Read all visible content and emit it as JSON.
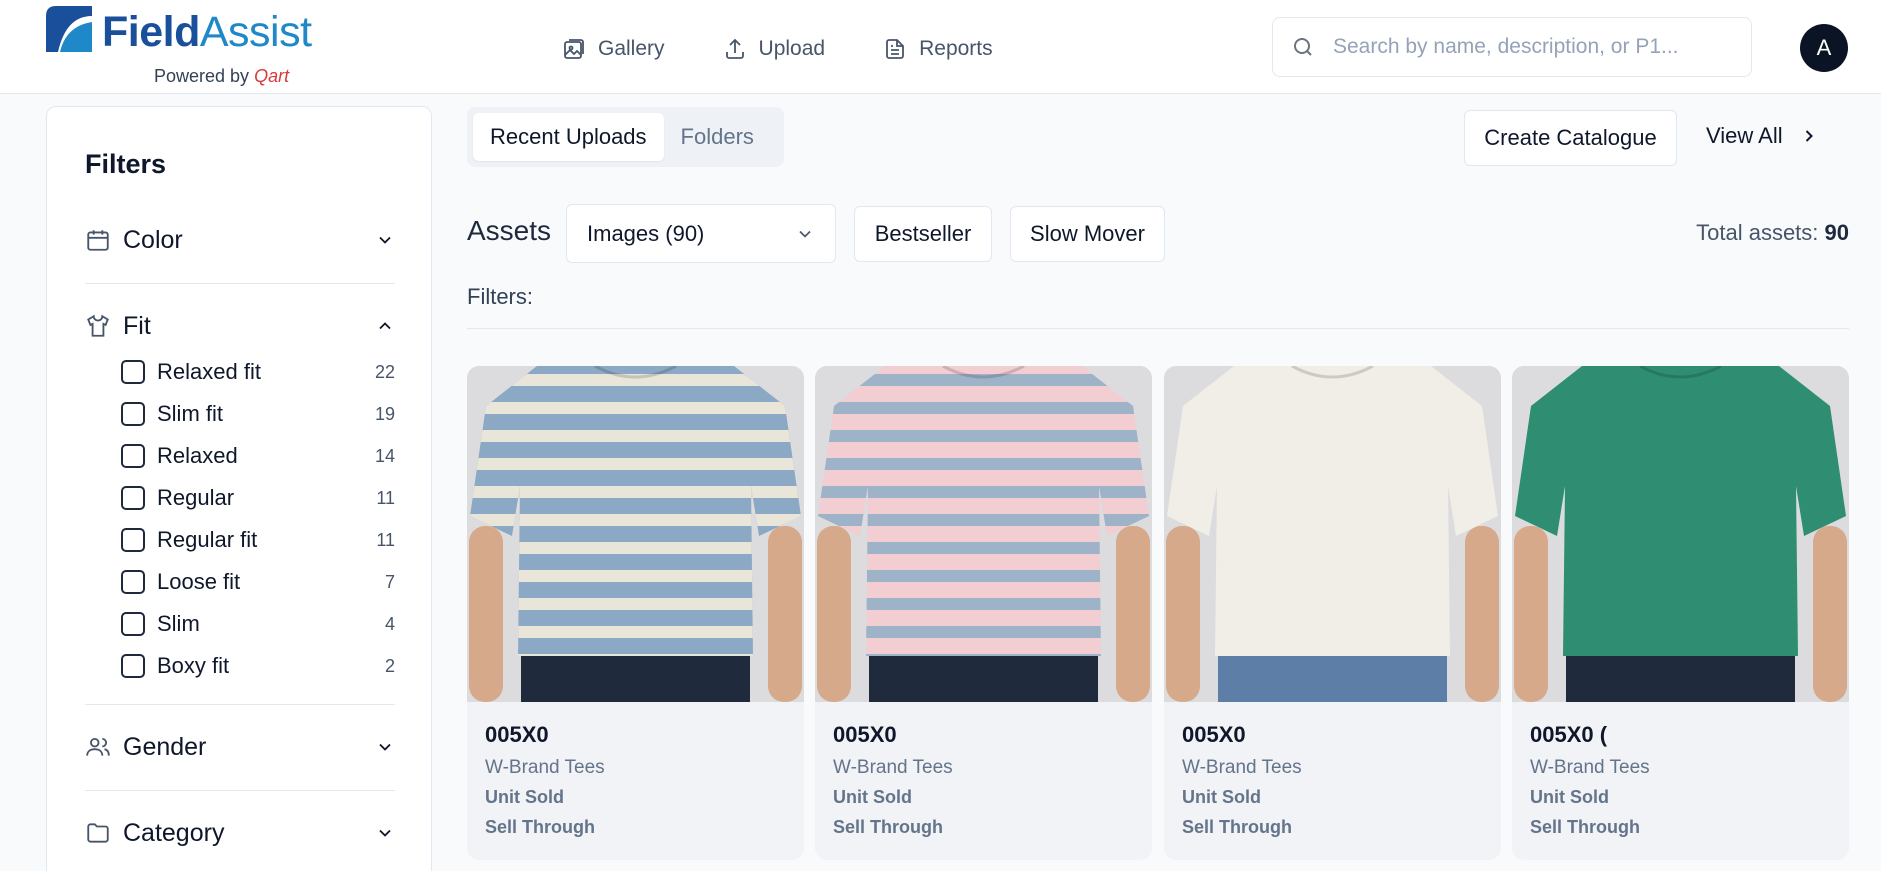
{
  "header": {
    "logo_primary": "Field",
    "logo_secondary": "Assist",
    "powered_prefix": "Powered by ",
    "powered_brand": "Qart",
    "nav": [
      {
        "label": "Gallery",
        "icon": "gallery-icon"
      },
      {
        "label": "Upload",
        "icon": "upload-icon"
      },
      {
        "label": "Reports",
        "icon": "reports-icon"
      }
    ],
    "search_placeholder": "Search by name, description, or P1...",
    "avatar_initial": "A"
  },
  "sidebar": {
    "title": "Filters",
    "sections": [
      {
        "label": "Color",
        "icon": "calendar-icon",
        "expanded": false
      },
      {
        "label": "Fit",
        "icon": "shirt-icon",
        "expanded": true,
        "options": [
          {
            "label": "Relaxed fit",
            "count": "22"
          },
          {
            "label": "Slim fit",
            "count": "19"
          },
          {
            "label": "Relaxed",
            "count": "14"
          },
          {
            "label": "Regular",
            "count": "11"
          },
          {
            "label": "Regular fit",
            "count": "11"
          },
          {
            "label": "Loose fit",
            "count": "7"
          },
          {
            "label": "Slim",
            "count": "4"
          },
          {
            "label": "Boxy fit",
            "count": "2"
          }
        ]
      },
      {
        "label": "Gender",
        "icon": "users-icon",
        "expanded": false
      },
      {
        "label": "Category",
        "icon": "folder-icon",
        "expanded": false
      }
    ]
  },
  "main": {
    "tabs": [
      {
        "label": "Recent Uploads",
        "active": true
      },
      {
        "label": "Folders",
        "active": false
      }
    ],
    "create_catalogue": "Create Catalogue",
    "view_all": "View All",
    "assets_label": "Assets",
    "asset_type_selected": "Images (90)",
    "bestseller": "Bestseller",
    "slow_mover": "Slow Mover",
    "total_label": "Total assets: ",
    "total_value": "90",
    "filters_label": "Filters:",
    "cards": [
      {
        "title": "005X0",
        "brand": "W-Brand Tees",
        "unit_sold": "Unit Sold",
        "sell_through": "Sell Through",
        "shirt_color": "#8ba8c4",
        "stripe_color": "#e9e5d8",
        "striped": true,
        "jeans_color": "#1f2a3d"
      },
      {
        "title": "005X0",
        "brand": "W-Brand Tees",
        "unit_sold": "Unit Sold",
        "sell_through": "Sell Through",
        "shirt_color": "#f2cdd2",
        "stripe_color": "#9eb3c7",
        "striped": true,
        "jeans_color": "#1f2a3d"
      },
      {
        "title": "005X0",
        "brand": "W-Brand Tees",
        "unit_sold": "Unit Sold",
        "sell_through": "Sell Through",
        "shirt_color": "#f1eee7",
        "stripe_color": "",
        "striped": false,
        "jeans_color": "#5d7ea6"
      },
      {
        "title": "005X0 (",
        "brand": "W-Brand Tees",
        "unit_sold": "Unit Sold",
        "sell_through": "Sell Through",
        "shirt_color": "#2f8e72",
        "stripe_color": "",
        "striped": false,
        "jeans_color": "#1f2a3d"
      }
    ]
  }
}
